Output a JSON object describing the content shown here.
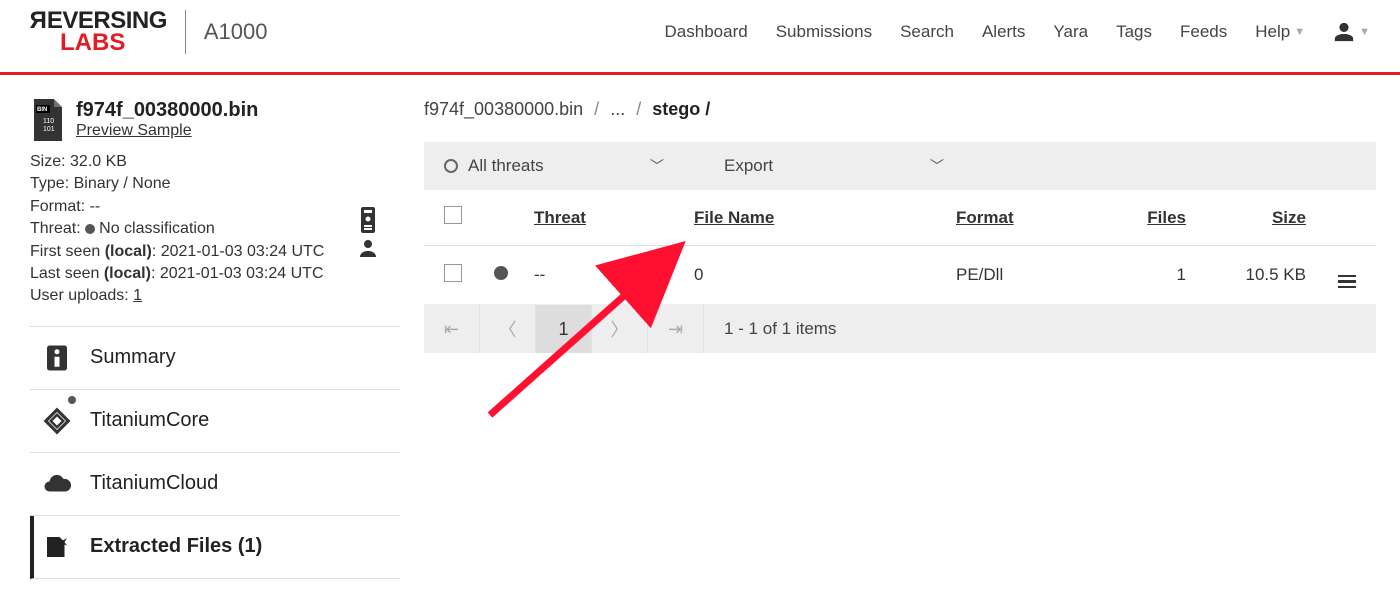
{
  "product": "A1000",
  "nav": [
    "Dashboard",
    "Submissions",
    "Search",
    "Alerts",
    "Yara",
    "Tags",
    "Feeds",
    "Help"
  ],
  "file": {
    "name": "f974f_00380000.bin",
    "preview": "Preview Sample",
    "size_label": "Size:",
    "size": "32.0 KB",
    "type_label": "Type:",
    "type": "Binary / None",
    "format_label": "Format:",
    "format": "--",
    "threat_label": "Threat:",
    "threat": "No classification",
    "first_seen_label": "First seen ",
    "first_seen_scope": "(local)",
    "first_seen": ": 2021-01-03 03:24 UTC",
    "last_seen_label": "Last seen ",
    "last_seen_scope": "(local)",
    "last_seen": ": 2021-01-03 03:24 UTC",
    "uploads_label": "User uploads: ",
    "uploads": "1"
  },
  "side_nav": {
    "summary": "Summary",
    "core": "TitaniumCore",
    "cloud": "TitaniumCloud",
    "extracted": "Extracted Files (1)"
  },
  "breadcrumb": {
    "root": "f974f_00380000.bin",
    "mid": "...",
    "leaf": "stego /"
  },
  "filters": {
    "all_threats": "All threats",
    "export": "Export"
  },
  "table": {
    "headers": {
      "threat": "Threat",
      "fname": "File Name",
      "format": "Format",
      "files": "Files",
      "size": "Size"
    },
    "row": {
      "threat": "--",
      "fname": "0",
      "format": "PE/Dll",
      "files": "1",
      "size": "10.5 KB"
    },
    "pager": {
      "page": "1",
      "summary": "1 - 1 of 1 items"
    }
  }
}
